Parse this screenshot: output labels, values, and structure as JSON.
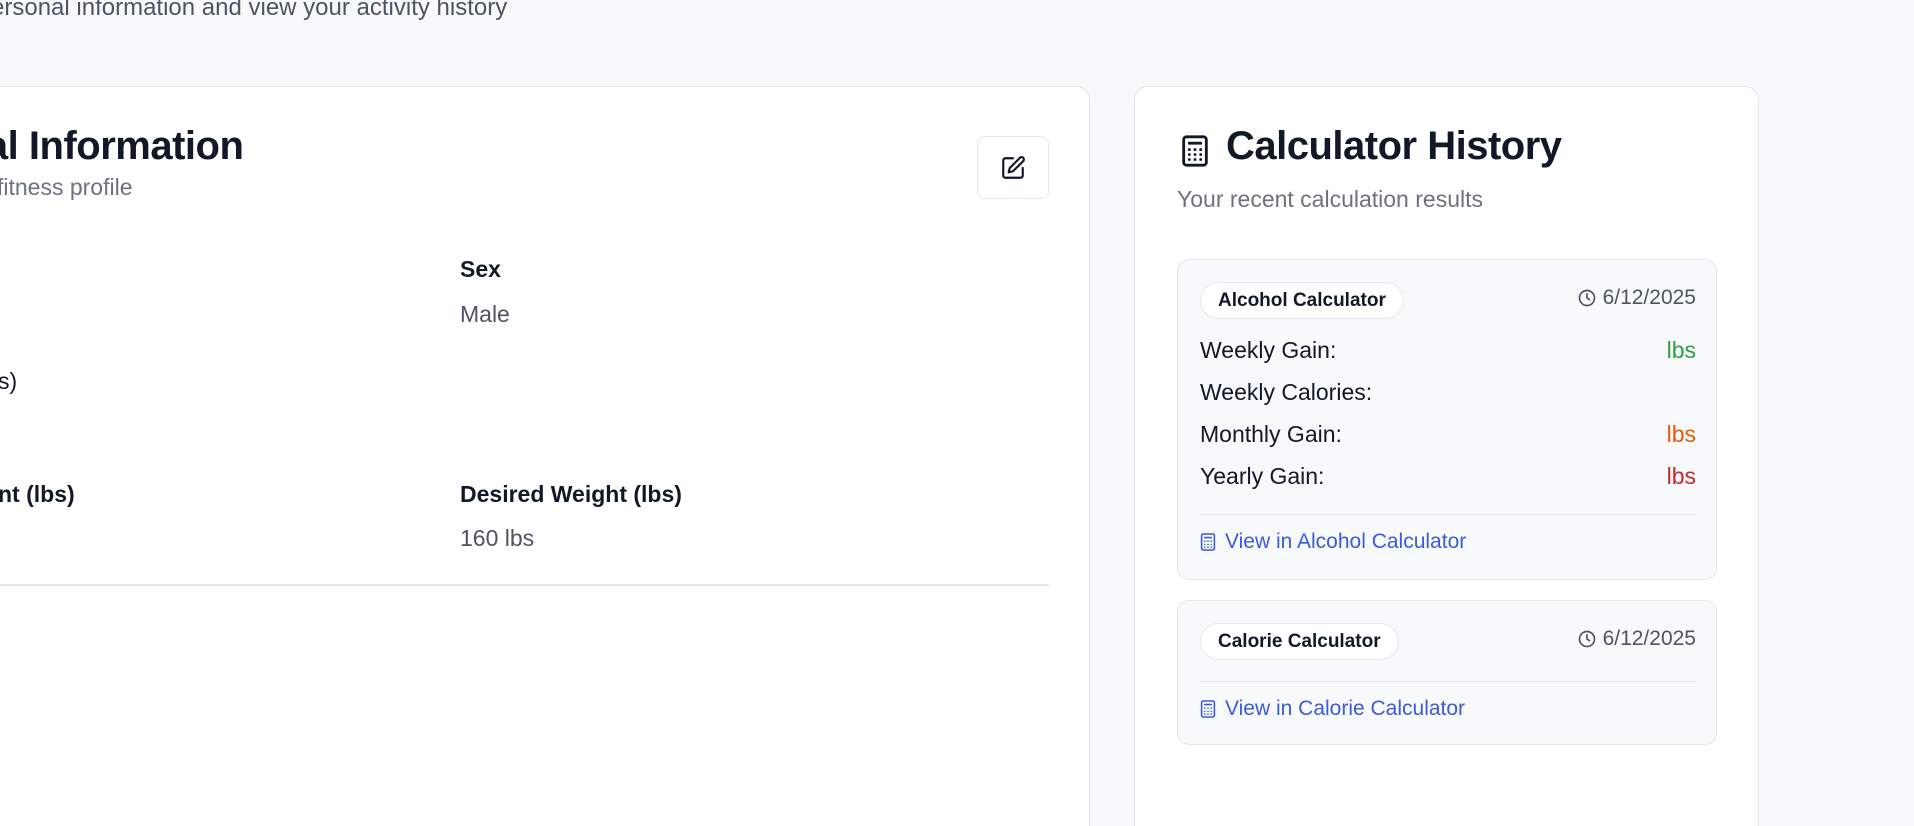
{
  "header": {
    "subtitle": "ersonal information and view your activity history"
  },
  "profile": {
    "title": "nal Information",
    "description": "nd fitness profile",
    "edit_icon": "edit-icon",
    "fields": {
      "sex_label": "Sex",
      "sex_value": "Male",
      "partial_label_1": "s)",
      "partial_label_2": "nt (lbs)",
      "desired_weight_label": "Desired Weight (lbs)",
      "desired_weight_value": "160 lbs"
    }
  },
  "history": {
    "title": "Calculator History",
    "description": "Your recent calculation results",
    "title_icon": "calculator-icon",
    "entries": [
      {
        "calculator": "Alcohol Calculator",
        "date": "6/12/2025",
        "results": [
          {
            "label": "Weekly Gain:",
            "value": "lbs",
            "color": "#2f9e44"
          },
          {
            "label": "Weekly Calories:",
            "value": "",
            "color": "#111827"
          },
          {
            "label": "Monthly Gain:",
            "value": "lbs",
            "color": "#e8590c"
          },
          {
            "label": "Yearly Gain:",
            "value": "lbs",
            "color": "#c92a2a"
          }
        ],
        "link": "View in Alcohol Calculator"
      },
      {
        "calculator": "Calorie Calculator",
        "date": "6/12/2025",
        "results": [],
        "link": "View in Calorie Calculator"
      }
    ]
  },
  "colors": {
    "link": "#3b5bdb",
    "gain_weekly": "#2f9e44",
    "gain_monthly": "#e8590c",
    "gain_yearly": "#c92a2a"
  }
}
